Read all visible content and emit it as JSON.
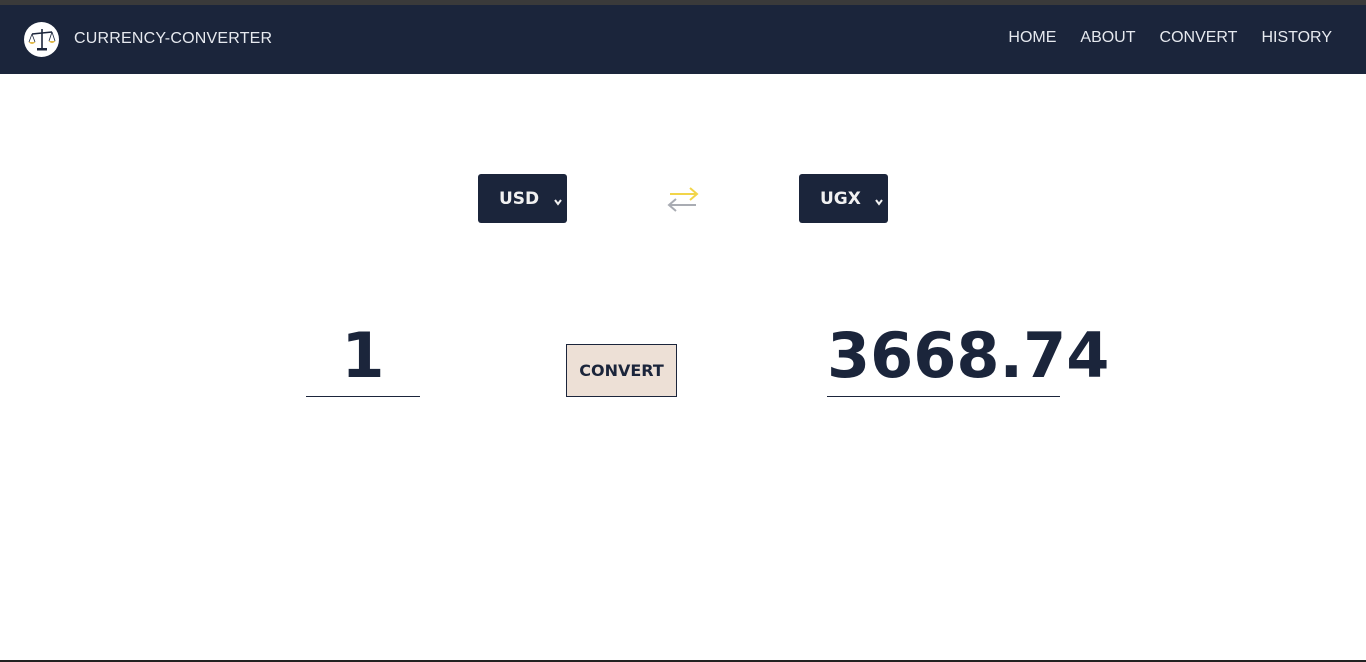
{
  "header": {
    "brand": "CURRENCY-CONVERTER",
    "logo_icon": "scales-icon",
    "nav": [
      "HOME",
      "ABOUT",
      "CONVERT",
      "HISTORY"
    ]
  },
  "converter": {
    "from_currency": "USD",
    "to_currency": "UGX",
    "swap_icon": "swap-arrows-icon",
    "amount": "1",
    "result": "3668.74",
    "convert_label": "CONVERT"
  },
  "colors": {
    "navbar": "#1b253b",
    "button": "#ede0d6",
    "swap_top_arrow": "#f2d54a",
    "swap_bottom_arrow": "#a9acb3"
  }
}
